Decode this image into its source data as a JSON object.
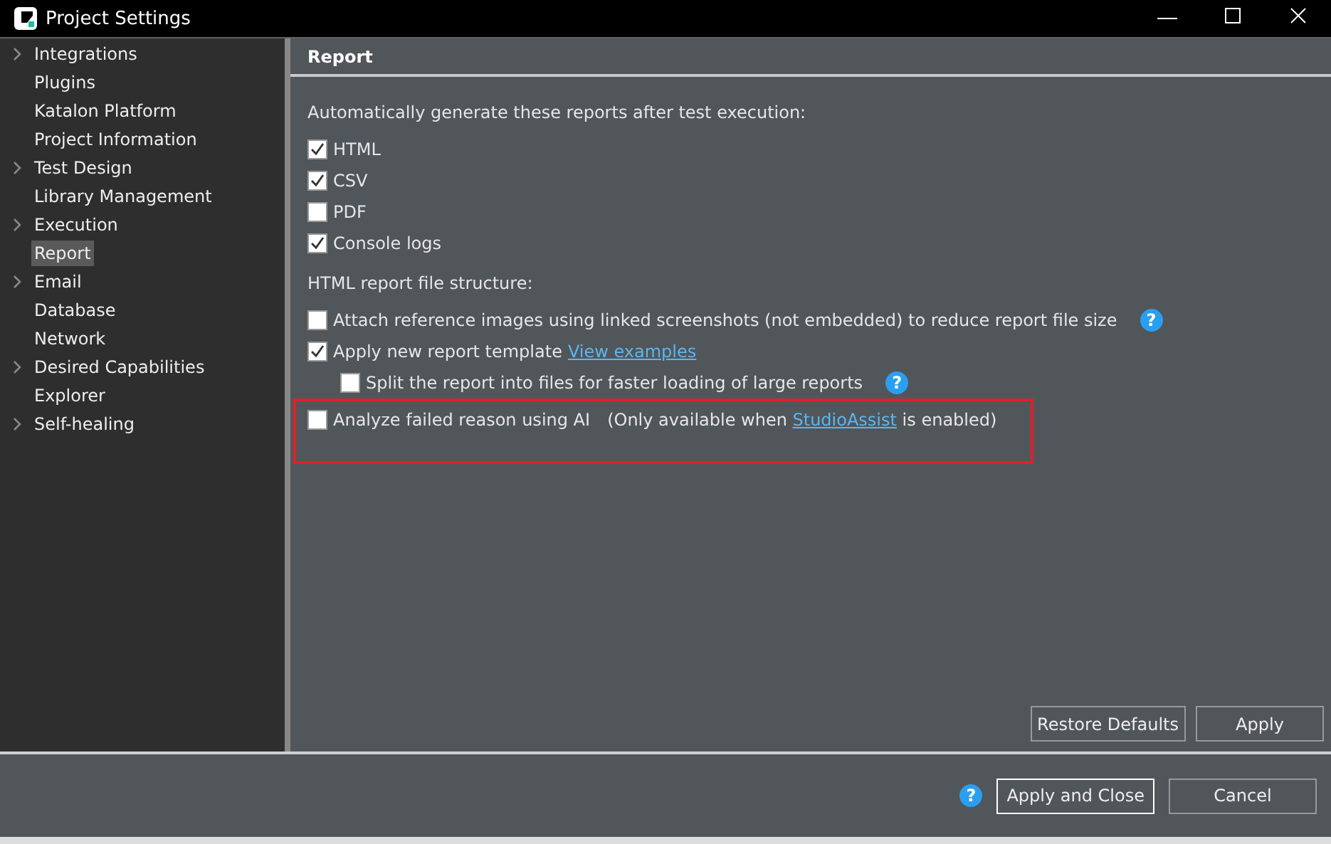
{
  "window": {
    "title": "Project Settings"
  },
  "sidebar": {
    "items": [
      {
        "label": "Integrations",
        "expandable": true,
        "selected": false
      },
      {
        "label": "Plugins",
        "expandable": false,
        "selected": false
      },
      {
        "label": "Katalon Platform",
        "expandable": false,
        "selected": false
      },
      {
        "label": "Project Information",
        "expandable": false,
        "selected": false
      },
      {
        "label": "Test Design",
        "expandable": true,
        "selected": false
      },
      {
        "label": "Library Management",
        "expandable": false,
        "selected": false
      },
      {
        "label": "Execution",
        "expandable": true,
        "selected": false
      },
      {
        "label": "Report",
        "expandable": false,
        "selected": true
      },
      {
        "label": "Email",
        "expandable": true,
        "selected": false
      },
      {
        "label": "Database",
        "expandable": false,
        "selected": false
      },
      {
        "label": "Network",
        "expandable": false,
        "selected": false
      },
      {
        "label": "Desired Capabilities",
        "expandable": true,
        "selected": false
      },
      {
        "label": "Explorer",
        "expandable": false,
        "selected": false
      },
      {
        "label": "Self-healing",
        "expandable": true,
        "selected": false
      }
    ]
  },
  "page": {
    "title": "Report",
    "sections": [
      {
        "heading": "Automatically generate these reports after test execution:",
        "options": [
          {
            "label": "HTML",
            "checked": true
          },
          {
            "label": "CSV",
            "checked": true
          },
          {
            "label": "PDF",
            "checked": false
          },
          {
            "label": "Console logs",
            "checked": true
          }
        ]
      },
      {
        "heading": "HTML report file structure:",
        "options": [
          {
            "label": "Attach reference images using linked screenshots (not embedded) to reduce report file size",
            "checked": false,
            "help": "?"
          },
          {
            "label": "Apply new report template",
            "checked": true,
            "link": "View examples",
            "children": [
              {
                "label": "Split the report into files for faster loading of large reports",
                "checked": false,
                "help": "?"
              }
            ]
          },
          {
            "label": "Analyze failed reason using AI",
            "checked": false,
            "highlighted": true,
            "note_before": "(Only available when",
            "note_link": "StudioAssist",
            "note_after": "is enabled)"
          }
        ]
      }
    ],
    "buttons": [
      "Restore Defaults",
      "Apply"
    ]
  },
  "footer": {
    "help": "?",
    "buttons": [
      {
        "label": "Apply and Close",
        "default": true
      },
      {
        "label": "Cancel",
        "default": false
      }
    ]
  }
}
